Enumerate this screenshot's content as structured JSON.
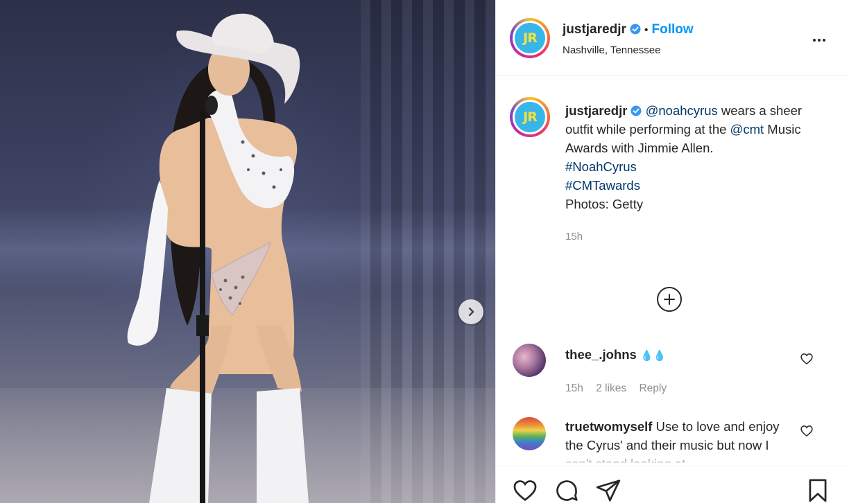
{
  "post": {
    "username": "justjaredjr",
    "avatar_text": "JR",
    "verified": true,
    "follow_label": "Follow",
    "separator": "•",
    "location": "Nashville, Tennessee"
  },
  "caption": {
    "username": "justjaredjr",
    "mention_1": "@noahcyrus",
    "text_1": " wears a sheer outfit while performing at the ",
    "mention_2": "@cmt",
    "text_2": " Music Awards with Jimmie Allen.",
    "hashtag_1": "#NoahCyrus",
    "hashtag_2": "#CMTawards",
    "credit": "Photos: Getty",
    "time": "15h"
  },
  "comments": [
    {
      "username": "thee_.johns",
      "text": "",
      "emoji": "💧💧",
      "time": "15h",
      "likes": "2 likes",
      "reply_label": "Reply"
    },
    {
      "username": "truetwomyself",
      "text": " Use to love and enjoy the Cyrus' and their music but now I can't stand looking at"
    }
  ],
  "icons": {
    "next": "chevron-right-icon",
    "more": "more-horizontal-icon",
    "load_more": "plus-circle-icon",
    "like": "heart-icon",
    "comment": "comment-bubble-icon",
    "share": "paper-plane-icon",
    "save": "bookmark-icon",
    "verified": "verified-badge-icon"
  },
  "colors": {
    "link": "#00376b",
    "follow": "#0095f6",
    "verified": "#3897f0",
    "muted": "#8e8e8e"
  }
}
